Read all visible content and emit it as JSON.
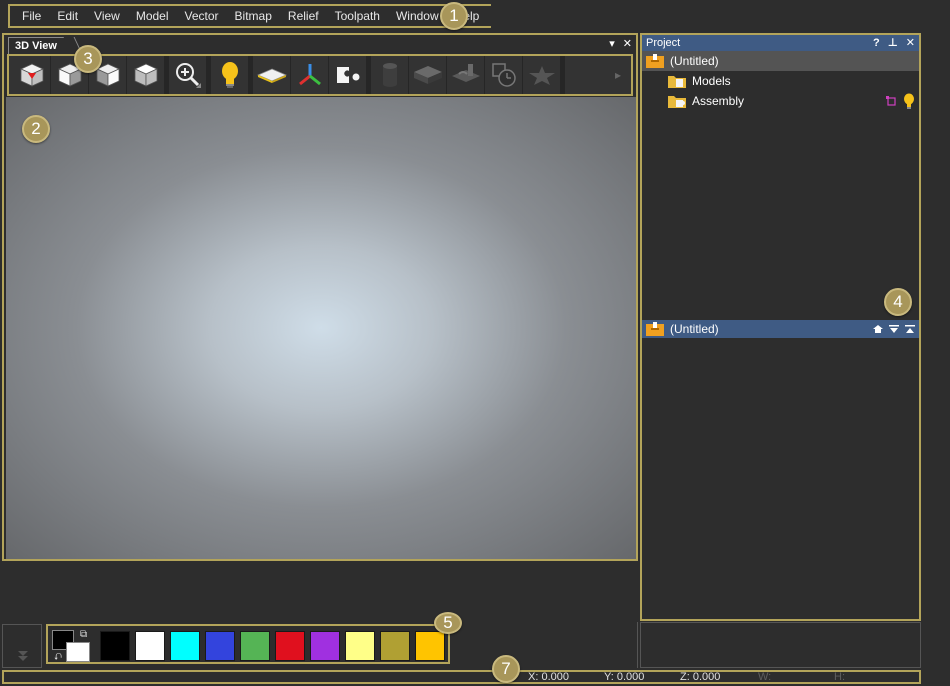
{
  "menu": {
    "items": [
      "File",
      "Edit",
      "View",
      "Model",
      "Vector",
      "Bitmap",
      "Relief",
      "Toolpath",
      "Window",
      "Help"
    ]
  },
  "badges": {
    "menu": "1",
    "view": "2",
    "toolbar": "3",
    "project": "4",
    "palette": "5",
    "status": "7"
  },
  "view": {
    "tab_label": "3D View",
    "dropdown_glyph": "▾",
    "close_glyph": "✕"
  },
  "toolbar": {
    "buttons": [
      "iso-view-icon",
      "front-view-icon",
      "side-view-icon",
      "top-view-icon",
      "zoom-icon",
      "lightbulb-icon",
      "plane-icon",
      "axes-icon",
      "puzzle-icon",
      "cylinder-icon",
      "slab-icon",
      "toolpath-tool-icon",
      "timer-icon",
      "star-icon"
    ],
    "overflow_glyph": "▸"
  },
  "project_panel": {
    "title": "Project",
    "help_glyph": "?",
    "pin_glyph": "⊥",
    "close_glyph": "✕",
    "tree": [
      {
        "label": "(Untitled)",
        "icon": "project-icon"
      },
      {
        "label": "Models",
        "icon": "models-folder-icon"
      },
      {
        "label": "Assembly",
        "icon": "assembly-folder-icon"
      }
    ],
    "lower_title": "(Untitled)"
  },
  "palette": {
    "colors": [
      "#000000",
      "#ffffff",
      "#00ffff",
      "#3344dd",
      "#55b455",
      "#e0101e",
      "#a030e0",
      "#ffff88",
      "#b0a033",
      "#ffc400"
    ]
  },
  "status": {
    "x": "X: 0.000",
    "y": "Y: 0.000",
    "z": "Z: 0.000",
    "w": "W:",
    "h": "H:"
  },
  "colors": {
    "accent_border": "#b3a45a",
    "panel_title": "#3f5b84",
    "background": "#2d2d2d"
  }
}
